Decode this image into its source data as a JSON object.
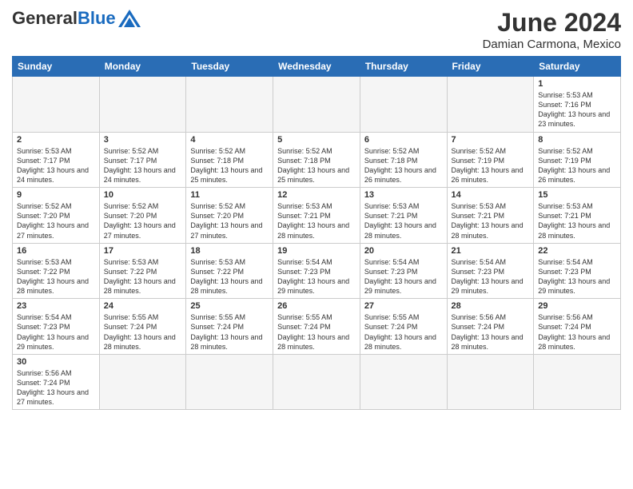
{
  "logo": {
    "general": "General",
    "blue": "Blue"
  },
  "title": "June 2024",
  "subtitle": "Damian Carmona, Mexico",
  "days_of_week": [
    "Sunday",
    "Monday",
    "Tuesday",
    "Wednesday",
    "Thursday",
    "Friday",
    "Saturday"
  ],
  "weeks": [
    [
      {
        "day": "",
        "info": ""
      },
      {
        "day": "",
        "info": ""
      },
      {
        "day": "",
        "info": ""
      },
      {
        "day": "",
        "info": ""
      },
      {
        "day": "",
        "info": ""
      },
      {
        "day": "",
        "info": ""
      },
      {
        "day": "1",
        "info": "Sunrise: 5:53 AM\nSunset: 7:16 PM\nDaylight: 13 hours and 23 minutes."
      }
    ],
    [
      {
        "day": "2",
        "info": "Sunrise: 5:53 AM\nSunset: 7:17 PM\nDaylight: 13 hours and 24 minutes."
      },
      {
        "day": "3",
        "info": "Sunrise: 5:52 AM\nSunset: 7:17 PM\nDaylight: 13 hours and 24 minutes."
      },
      {
        "day": "4",
        "info": "Sunrise: 5:52 AM\nSunset: 7:18 PM\nDaylight: 13 hours and 25 minutes."
      },
      {
        "day": "5",
        "info": "Sunrise: 5:52 AM\nSunset: 7:18 PM\nDaylight: 13 hours and 25 minutes."
      },
      {
        "day": "6",
        "info": "Sunrise: 5:52 AM\nSunset: 7:18 PM\nDaylight: 13 hours and 26 minutes."
      },
      {
        "day": "7",
        "info": "Sunrise: 5:52 AM\nSunset: 7:19 PM\nDaylight: 13 hours and 26 minutes."
      },
      {
        "day": "8",
        "info": "Sunrise: 5:52 AM\nSunset: 7:19 PM\nDaylight: 13 hours and 26 minutes."
      }
    ],
    [
      {
        "day": "9",
        "info": "Sunrise: 5:52 AM\nSunset: 7:20 PM\nDaylight: 13 hours and 27 minutes."
      },
      {
        "day": "10",
        "info": "Sunrise: 5:52 AM\nSunset: 7:20 PM\nDaylight: 13 hours and 27 minutes."
      },
      {
        "day": "11",
        "info": "Sunrise: 5:52 AM\nSunset: 7:20 PM\nDaylight: 13 hours and 27 minutes."
      },
      {
        "day": "12",
        "info": "Sunrise: 5:53 AM\nSunset: 7:21 PM\nDaylight: 13 hours and 28 minutes."
      },
      {
        "day": "13",
        "info": "Sunrise: 5:53 AM\nSunset: 7:21 PM\nDaylight: 13 hours and 28 minutes."
      },
      {
        "day": "14",
        "info": "Sunrise: 5:53 AM\nSunset: 7:21 PM\nDaylight: 13 hours and 28 minutes."
      },
      {
        "day": "15",
        "info": "Sunrise: 5:53 AM\nSunset: 7:21 PM\nDaylight: 13 hours and 28 minutes."
      }
    ],
    [
      {
        "day": "16",
        "info": "Sunrise: 5:53 AM\nSunset: 7:22 PM\nDaylight: 13 hours and 28 minutes."
      },
      {
        "day": "17",
        "info": "Sunrise: 5:53 AM\nSunset: 7:22 PM\nDaylight: 13 hours and 28 minutes."
      },
      {
        "day": "18",
        "info": "Sunrise: 5:53 AM\nSunset: 7:22 PM\nDaylight: 13 hours and 28 minutes."
      },
      {
        "day": "19",
        "info": "Sunrise: 5:54 AM\nSunset: 7:23 PM\nDaylight: 13 hours and 29 minutes."
      },
      {
        "day": "20",
        "info": "Sunrise: 5:54 AM\nSunset: 7:23 PM\nDaylight: 13 hours and 29 minutes."
      },
      {
        "day": "21",
        "info": "Sunrise: 5:54 AM\nSunset: 7:23 PM\nDaylight: 13 hours and 29 minutes."
      },
      {
        "day": "22",
        "info": "Sunrise: 5:54 AM\nSunset: 7:23 PM\nDaylight: 13 hours and 29 minutes."
      }
    ],
    [
      {
        "day": "23",
        "info": "Sunrise: 5:54 AM\nSunset: 7:23 PM\nDaylight: 13 hours and 29 minutes."
      },
      {
        "day": "24",
        "info": "Sunrise: 5:55 AM\nSunset: 7:24 PM\nDaylight: 13 hours and 28 minutes."
      },
      {
        "day": "25",
        "info": "Sunrise: 5:55 AM\nSunset: 7:24 PM\nDaylight: 13 hours and 28 minutes."
      },
      {
        "day": "26",
        "info": "Sunrise: 5:55 AM\nSunset: 7:24 PM\nDaylight: 13 hours and 28 minutes."
      },
      {
        "day": "27",
        "info": "Sunrise: 5:55 AM\nSunset: 7:24 PM\nDaylight: 13 hours and 28 minutes."
      },
      {
        "day": "28",
        "info": "Sunrise: 5:56 AM\nSunset: 7:24 PM\nDaylight: 13 hours and 28 minutes."
      },
      {
        "day": "29",
        "info": "Sunrise: 5:56 AM\nSunset: 7:24 PM\nDaylight: 13 hours and 28 minutes."
      }
    ],
    [
      {
        "day": "30",
        "info": "Sunrise: 5:56 AM\nSunset: 7:24 PM\nDaylight: 13 hours and 27 minutes."
      },
      {
        "day": "",
        "info": ""
      },
      {
        "day": "",
        "info": ""
      },
      {
        "day": "",
        "info": ""
      },
      {
        "day": "",
        "info": ""
      },
      {
        "day": "",
        "info": ""
      },
      {
        "day": "",
        "info": ""
      }
    ]
  ]
}
